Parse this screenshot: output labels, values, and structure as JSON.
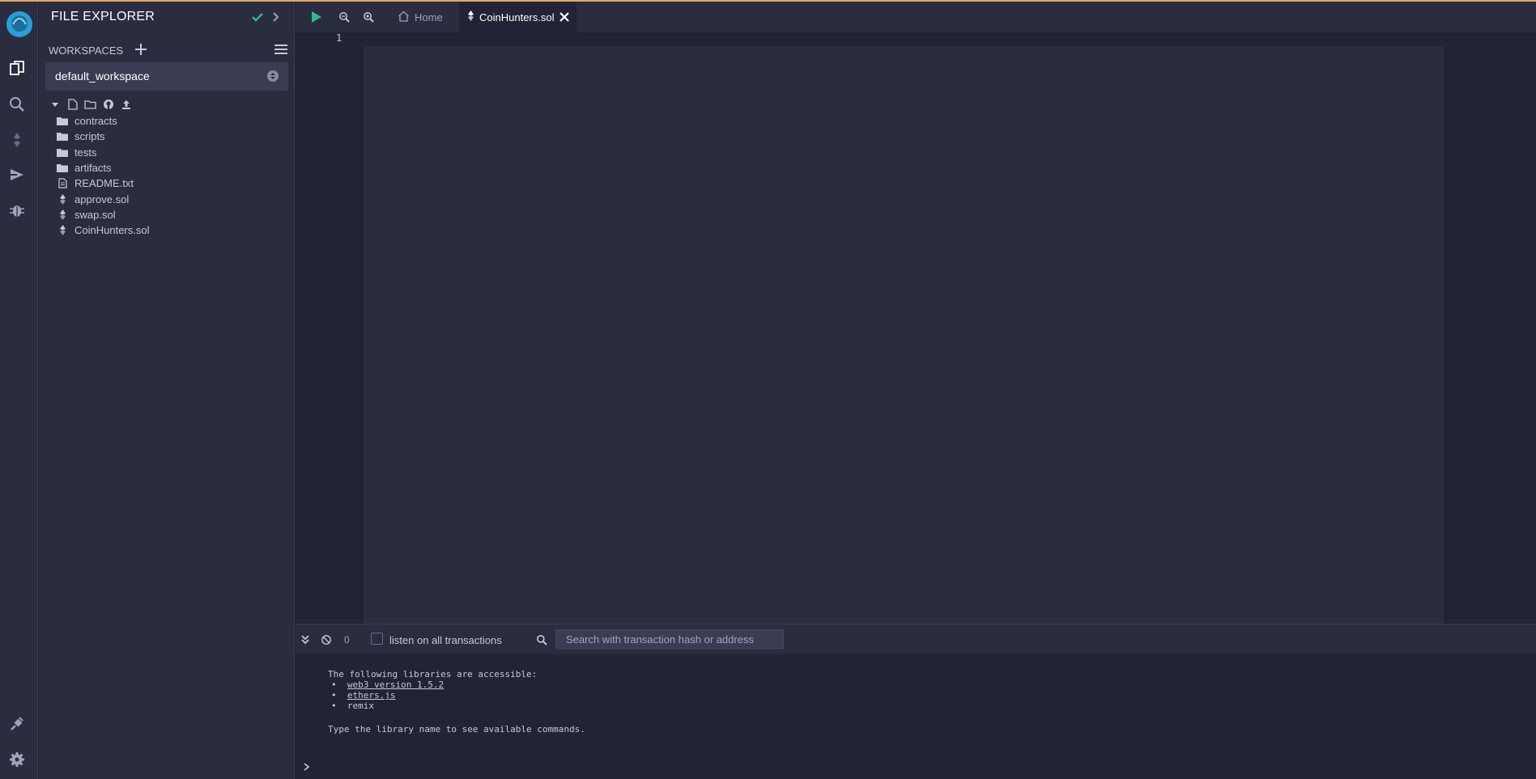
{
  "panel": {
    "title": "FILE EXPLORER"
  },
  "workspaces": {
    "label": "WORKSPACES",
    "selected": "default_workspace"
  },
  "files": [
    {
      "name": "contracts",
      "type": "folder"
    },
    {
      "name": "scripts",
      "type": "folder"
    },
    {
      "name": "tests",
      "type": "folder"
    },
    {
      "name": "artifacts",
      "type": "folder"
    },
    {
      "name": "README.txt",
      "type": "file"
    },
    {
      "name": "approve.sol",
      "type": "solidity"
    },
    {
      "name": "swap.sol",
      "type": "solidity"
    },
    {
      "name": "CoinHunters.sol",
      "type": "solidity"
    }
  ],
  "tabs": {
    "home": "Home",
    "active": "CoinHunters.sol"
  },
  "editor": {
    "line_number": "1"
  },
  "terminal": {
    "count": "0",
    "listen_label": "listen on all transactions",
    "search_placeholder": "Search with transaction hash or address",
    "intro": "The following libraries are accessible:",
    "libraries": [
      "web3 version 1.5.2",
      "ethers.js",
      "remix"
    ],
    "hint": "Type the library name to see available commands."
  },
  "colors": {
    "accent_top_border": "#e6a760",
    "logo_blue": "#2a9fd6",
    "success_green": "#32ba89",
    "background": "#222336",
    "panel": "#2a2c3f"
  }
}
